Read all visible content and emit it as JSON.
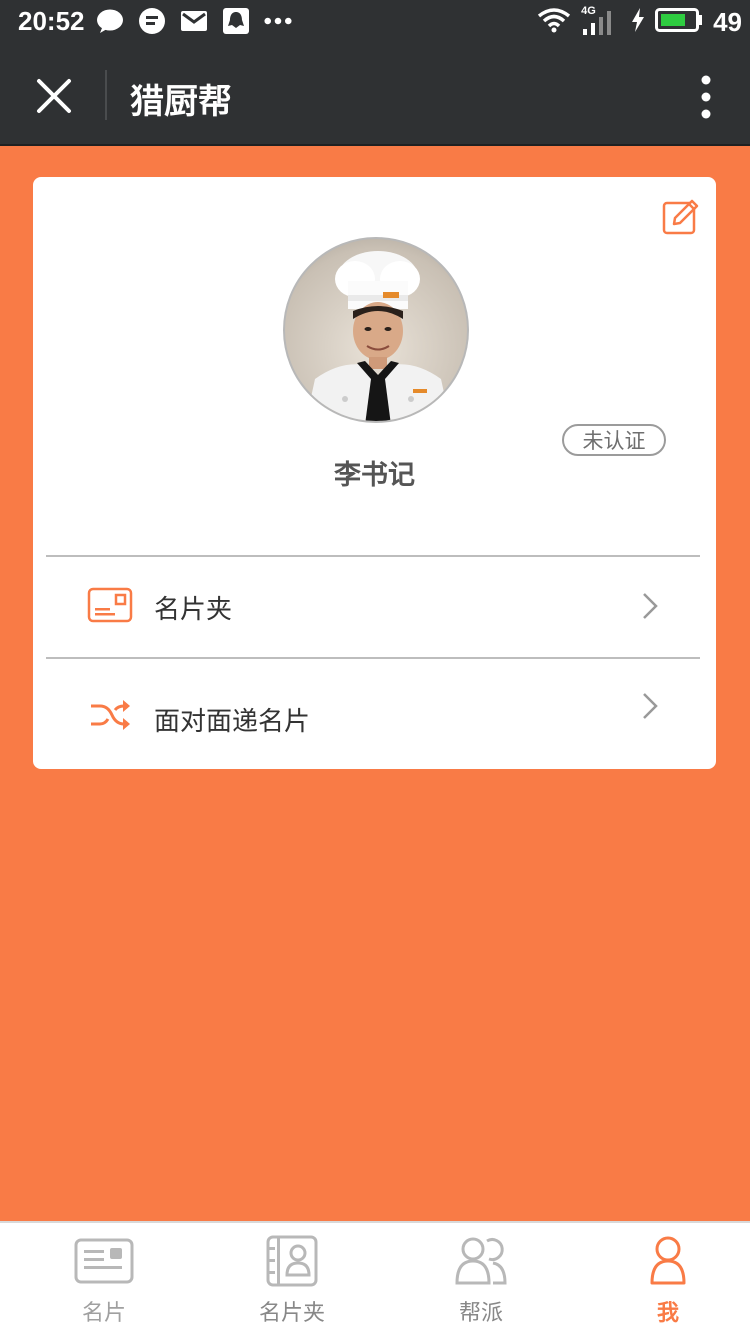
{
  "status_bar": {
    "time": "20:52",
    "network": "4G",
    "battery": "49"
  },
  "nav": {
    "title": "猎厨帮"
  },
  "profile": {
    "name": "李书记",
    "verification_status": "未认证"
  },
  "menu": {
    "items": [
      {
        "label": "名片夹",
        "icon": "card-icon"
      },
      {
        "label": "面对面递名片",
        "icon": "shuffle-icon"
      }
    ]
  },
  "tabs": [
    {
      "label": "名片",
      "icon": "business-card-icon"
    },
    {
      "label": "名片夹",
      "icon": "contacts-book-icon"
    },
    {
      "label": "帮派",
      "icon": "group-icon"
    },
    {
      "label": "我",
      "icon": "person-icon"
    }
  ],
  "colors": {
    "accent": "#f97b46",
    "header": "#2f3133",
    "inactive_tab": "#a0a0a0"
  }
}
